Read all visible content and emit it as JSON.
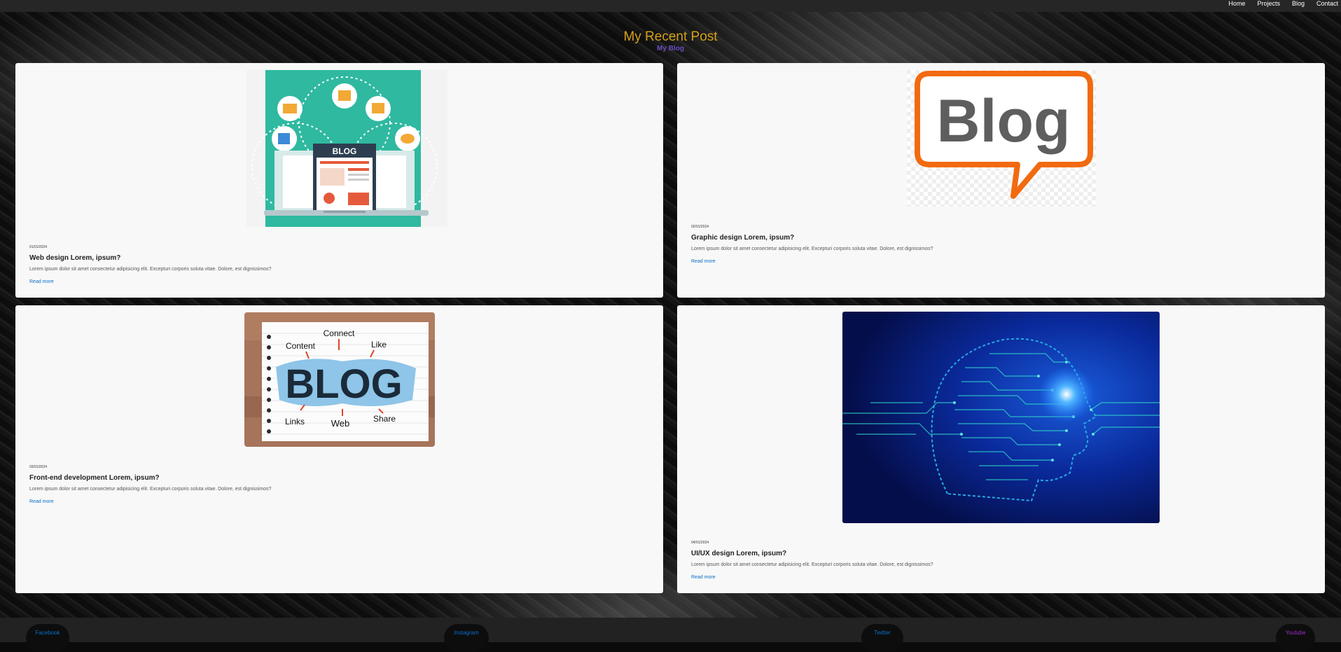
{
  "nav": {
    "items": [
      "Home",
      "Projects",
      "Blog",
      "Contact"
    ]
  },
  "header": {
    "title": "My Recent Post",
    "subtitle": "My Blog"
  },
  "posts": [
    {
      "date": "01/01/2024",
      "title": "Web design Lorem, ipsum?",
      "desc": "Lorem ipsum dolor sit amet consectetur adipisicing elit. Excepturi corporis soluta vitae. Dolore, est dignissimos?",
      "link": "Read more",
      "image": {
        "caption": "BLOG"
      }
    },
    {
      "date": "02/01/2024",
      "title": "Graphic design Lorem, ipsum?",
      "desc": "Lorem ipsum dolor sit amet consectetur adipisicing elit. Excepturi corporis soluta vitae. Dolore, est dignissimos?",
      "link": "Read more",
      "image": {
        "caption": "Blog"
      }
    },
    {
      "date": "03/01/2024",
      "title": "Front-end development Lorem, ipsum?",
      "desc": "Lorem ipsum dolor sit amet consectetur adipisicing elit. Excepturi corporis soluta vitae. Dolore, est dignissimos?",
      "link": "Read more",
      "image": {
        "caption": "BLOG",
        "words": [
          "Content",
          "Connect",
          "Like",
          "Links",
          "Web",
          "Share"
        ]
      }
    },
    {
      "date": "04/01/2024",
      "title": "UI/UX design Lorem, ipsum?",
      "desc": "Lorem ipsum dolor sit amet consectetur adipisicing elit. Excepturi corporis soluta vitae. Dolore, est dignissimos?",
      "link": "Read more"
    }
  ],
  "footer": {
    "links": [
      "Facebook",
      "Instagram",
      "Twitter",
      "Youtube"
    ]
  },
  "colors": {
    "title": "#d4a017",
    "subtitle": "#6a4fc1",
    "link": "#0a6fc7",
    "youtube": "#9b30c8"
  }
}
